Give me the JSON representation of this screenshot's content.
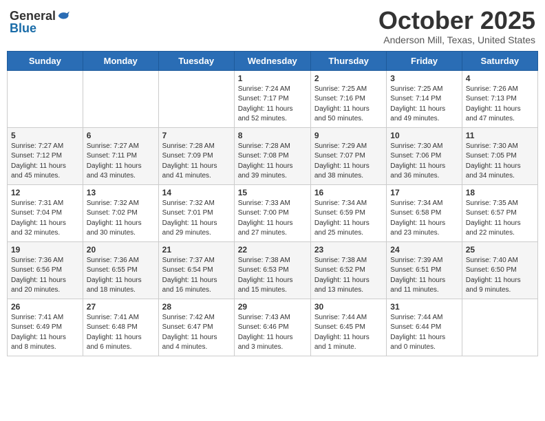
{
  "header": {
    "logo_general": "General",
    "logo_blue": "Blue",
    "month_title": "October 2025",
    "subtitle": "Anderson Mill, Texas, United States"
  },
  "days_of_week": [
    "Sunday",
    "Monday",
    "Tuesday",
    "Wednesday",
    "Thursday",
    "Friday",
    "Saturday"
  ],
  "weeks": [
    [
      {
        "day": "",
        "info": ""
      },
      {
        "day": "",
        "info": ""
      },
      {
        "day": "",
        "info": ""
      },
      {
        "day": "1",
        "info": "Sunrise: 7:24 AM\nSunset: 7:17 PM\nDaylight: 11 hours\nand 52 minutes."
      },
      {
        "day": "2",
        "info": "Sunrise: 7:25 AM\nSunset: 7:16 PM\nDaylight: 11 hours\nand 50 minutes."
      },
      {
        "day": "3",
        "info": "Sunrise: 7:25 AM\nSunset: 7:14 PM\nDaylight: 11 hours\nand 49 minutes."
      },
      {
        "day": "4",
        "info": "Sunrise: 7:26 AM\nSunset: 7:13 PM\nDaylight: 11 hours\nand 47 minutes."
      }
    ],
    [
      {
        "day": "5",
        "info": "Sunrise: 7:27 AM\nSunset: 7:12 PM\nDaylight: 11 hours\nand 45 minutes."
      },
      {
        "day": "6",
        "info": "Sunrise: 7:27 AM\nSunset: 7:11 PM\nDaylight: 11 hours\nand 43 minutes."
      },
      {
        "day": "7",
        "info": "Sunrise: 7:28 AM\nSunset: 7:09 PM\nDaylight: 11 hours\nand 41 minutes."
      },
      {
        "day": "8",
        "info": "Sunrise: 7:28 AM\nSunset: 7:08 PM\nDaylight: 11 hours\nand 39 minutes."
      },
      {
        "day": "9",
        "info": "Sunrise: 7:29 AM\nSunset: 7:07 PM\nDaylight: 11 hours\nand 38 minutes."
      },
      {
        "day": "10",
        "info": "Sunrise: 7:30 AM\nSunset: 7:06 PM\nDaylight: 11 hours\nand 36 minutes."
      },
      {
        "day": "11",
        "info": "Sunrise: 7:30 AM\nSunset: 7:05 PM\nDaylight: 11 hours\nand 34 minutes."
      }
    ],
    [
      {
        "day": "12",
        "info": "Sunrise: 7:31 AM\nSunset: 7:04 PM\nDaylight: 11 hours\nand 32 minutes."
      },
      {
        "day": "13",
        "info": "Sunrise: 7:32 AM\nSunset: 7:02 PM\nDaylight: 11 hours\nand 30 minutes."
      },
      {
        "day": "14",
        "info": "Sunrise: 7:32 AM\nSunset: 7:01 PM\nDaylight: 11 hours\nand 29 minutes."
      },
      {
        "day": "15",
        "info": "Sunrise: 7:33 AM\nSunset: 7:00 PM\nDaylight: 11 hours\nand 27 minutes."
      },
      {
        "day": "16",
        "info": "Sunrise: 7:34 AM\nSunset: 6:59 PM\nDaylight: 11 hours\nand 25 minutes."
      },
      {
        "day": "17",
        "info": "Sunrise: 7:34 AM\nSunset: 6:58 PM\nDaylight: 11 hours\nand 23 minutes."
      },
      {
        "day": "18",
        "info": "Sunrise: 7:35 AM\nSunset: 6:57 PM\nDaylight: 11 hours\nand 22 minutes."
      }
    ],
    [
      {
        "day": "19",
        "info": "Sunrise: 7:36 AM\nSunset: 6:56 PM\nDaylight: 11 hours\nand 20 minutes."
      },
      {
        "day": "20",
        "info": "Sunrise: 7:36 AM\nSunset: 6:55 PM\nDaylight: 11 hours\nand 18 minutes."
      },
      {
        "day": "21",
        "info": "Sunrise: 7:37 AM\nSunset: 6:54 PM\nDaylight: 11 hours\nand 16 minutes."
      },
      {
        "day": "22",
        "info": "Sunrise: 7:38 AM\nSunset: 6:53 PM\nDaylight: 11 hours\nand 15 minutes."
      },
      {
        "day": "23",
        "info": "Sunrise: 7:38 AM\nSunset: 6:52 PM\nDaylight: 11 hours\nand 13 minutes."
      },
      {
        "day": "24",
        "info": "Sunrise: 7:39 AM\nSunset: 6:51 PM\nDaylight: 11 hours\nand 11 minutes."
      },
      {
        "day": "25",
        "info": "Sunrise: 7:40 AM\nSunset: 6:50 PM\nDaylight: 11 hours\nand 9 minutes."
      }
    ],
    [
      {
        "day": "26",
        "info": "Sunrise: 7:41 AM\nSunset: 6:49 PM\nDaylight: 11 hours\nand 8 minutes."
      },
      {
        "day": "27",
        "info": "Sunrise: 7:41 AM\nSunset: 6:48 PM\nDaylight: 11 hours\nand 6 minutes."
      },
      {
        "day": "28",
        "info": "Sunrise: 7:42 AM\nSunset: 6:47 PM\nDaylight: 11 hours\nand 4 minutes."
      },
      {
        "day": "29",
        "info": "Sunrise: 7:43 AM\nSunset: 6:46 PM\nDaylight: 11 hours\nand 3 minutes."
      },
      {
        "day": "30",
        "info": "Sunrise: 7:44 AM\nSunset: 6:45 PM\nDaylight: 11 hours\nand 1 minute."
      },
      {
        "day": "31",
        "info": "Sunrise: 7:44 AM\nSunset: 6:44 PM\nDaylight: 11 hours\nand 0 minutes."
      },
      {
        "day": "",
        "info": ""
      }
    ]
  ]
}
